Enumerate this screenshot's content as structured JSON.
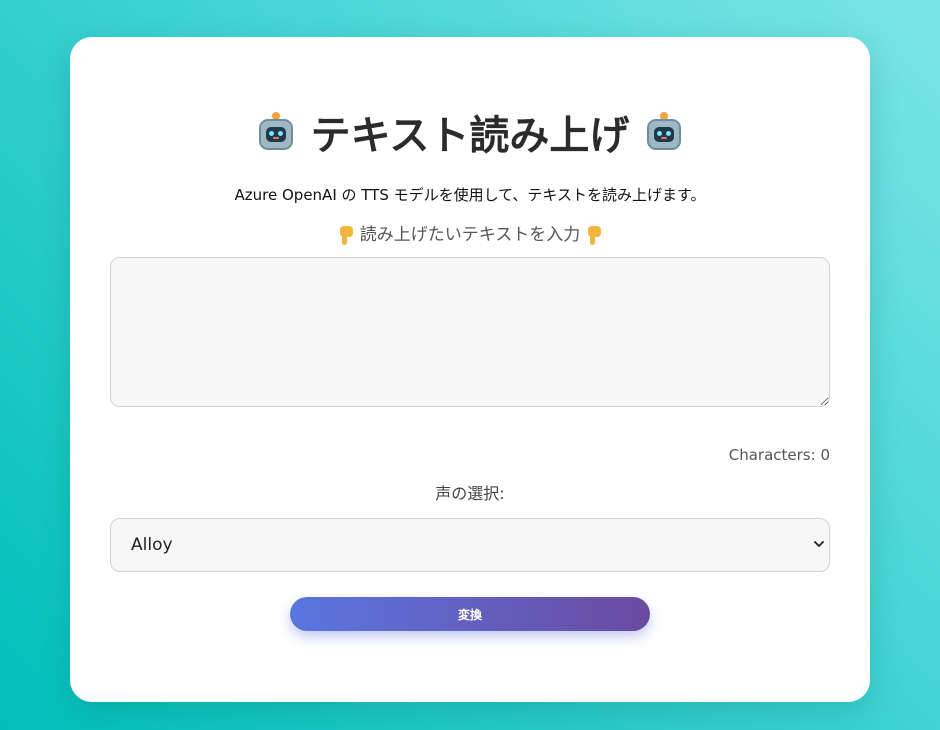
{
  "header": {
    "title": "テキスト読み上げ",
    "left_icon": "robot-icon",
    "right_icon": "robot-icon"
  },
  "description": "Azure OpenAI の TTS モデルを使用して、テキストを読み上げます。",
  "input_prompt": {
    "label": "読み上げたいテキストを入力",
    "left_icon": "pointing-down-icon",
    "right_icon": "pointing-down-icon"
  },
  "text_input": {
    "value": "",
    "placeholder": ""
  },
  "counter": {
    "label": "Characters: 0"
  },
  "voice": {
    "label": "声の選択:",
    "selected": "Alloy",
    "options": [
      "Alloy"
    ]
  },
  "actions": {
    "convert_label": "変換"
  },
  "colors": {
    "background_gradient": [
      "#00bfb9",
      "#7be5e6"
    ],
    "button_gradient": [
      "#5a76e0",
      "#6a4aa0"
    ],
    "card": "#ffffff"
  }
}
